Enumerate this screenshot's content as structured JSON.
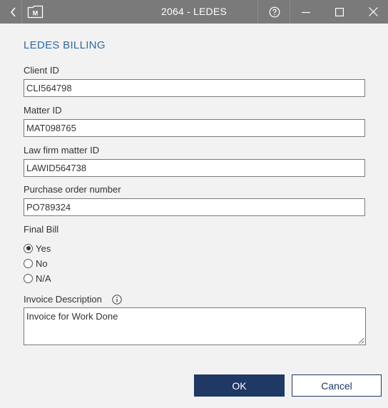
{
  "window": {
    "title": "2064 - LEDES",
    "logo_letter": "M"
  },
  "icons": {
    "back": "chevron-left-icon",
    "logo": "folder-logo-icon",
    "help": "question-circle-icon",
    "minimize": "minimize-icon",
    "maximize": "maximize-icon",
    "close": "close-icon",
    "info": "info-circle-icon"
  },
  "colors": {
    "titlebar": "#7a7a7a",
    "accent": "#2e6aa5",
    "primary_button": "#1f3864"
  },
  "form": {
    "section_title": "LEDES BILLING",
    "client_id": {
      "label": "Client ID",
      "value": "CLI564798"
    },
    "matter_id": {
      "label": "Matter ID",
      "value": "MAT098765"
    },
    "law_firm_matter_id": {
      "label": "Law firm matter ID",
      "value": "LAWID564738"
    },
    "purchase_order_number": {
      "label": "Purchase order number",
      "value": "PO789324"
    },
    "final_bill": {
      "label": "Final Bill",
      "options": [
        "Yes",
        "No",
        "N/A"
      ],
      "selected": "Yes"
    },
    "invoice_description": {
      "label": "Invoice Description",
      "value": "Invoice for Work Done"
    }
  },
  "buttons": {
    "ok": "OK",
    "cancel": "Cancel"
  }
}
